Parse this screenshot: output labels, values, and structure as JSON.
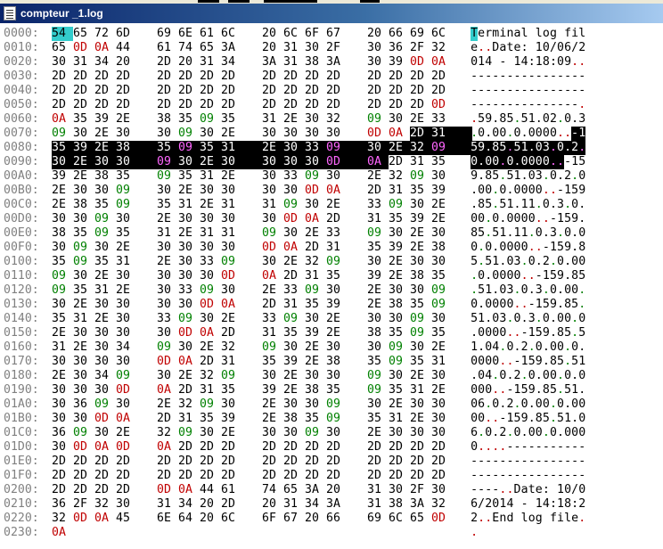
{
  "window": {
    "title": "compteur _1.log"
  },
  "colors": {
    "text": "#000000",
    "control": "#008000",
    "newline": "#c00000",
    "cursor": "#33cccc",
    "selection": "#000000"
  },
  "cursor_offset": 0,
  "selection_range": [
    126,
    156
  ],
  "rows": [
    {
      "addr": "0000:",
      "hex": "54 65 72 6D 69 6E 61 6C 20 6C 6F 67 20 66 69 6C",
      "ascii": "Terminal log fil"
    },
    {
      "addr": "0010:",
      "hex": "65 0D 0A 44 61 74 65 3A 20 31 30 2F 30 36 2F 32",
      "ascii": "e..Date: 10/06/2"
    },
    {
      "addr": "0020:",
      "hex": "30 31 34 20 2D 20 31 34 3A 31 38 3A 30 39 0D 0A",
      "ascii": "014 - 14:18:09.."
    },
    {
      "addr": "0030:",
      "hex": "2D 2D 2D 2D 2D 2D 2D 2D 2D 2D 2D 2D 2D 2D 2D 2D",
      "ascii": "----------------"
    },
    {
      "addr": "0040:",
      "hex": "2D 2D 2D 2D 2D 2D 2D 2D 2D 2D 2D 2D 2D 2D 2D 2D",
      "ascii": "----------------"
    },
    {
      "addr": "0050:",
      "hex": "2D 2D 2D 2D 2D 2D 2D 2D 2D 2D 2D 2D 2D 2D 2D 0D",
      "ascii": "---------------."
    },
    {
      "addr": "0060:",
      "hex": "0A 35 39 2E 38 35 09 35 31 2E 30 32 09 30 2E 33",
      "ascii": ".59.85.51.02.0.3"
    },
    {
      "addr": "0070:",
      "hex": "09 30 2E 30 30 09 30 2E 30 30 30 30 0D 0A 2D 31",
      "ascii": ".0.00.0.0000..-1"
    },
    {
      "addr": "0080:",
      "hex": "35 39 2E 38 35 09 35 31 2E 30 33 09 30 2E 32 09",
      "ascii": "59.85.51.03.0.2."
    },
    {
      "addr": "0090:",
      "hex": "30 2E 30 30 09 30 2E 30 30 30 30 0D 0A 2D 31 35",
      "ascii": "0.00.0.0000..-15"
    },
    {
      "addr": "00A0:",
      "hex": "39 2E 38 35 09 35 31 2E 30 33 09 30 2E 32 09 30",
      "ascii": "9.85.51.03.0.2.0"
    },
    {
      "addr": "00B0:",
      "hex": "2E 30 30 09 30 2E 30 30 30 30 0D 0A 2D 31 35 39",
      "ascii": ".00.0.0000..-159"
    },
    {
      "addr": "00C0:",
      "hex": "2E 38 35 09 35 31 2E 31 31 09 30 2E 33 09 30 2E",
      "ascii": ".85.51.11.0.3.0."
    },
    {
      "addr": "00D0:",
      "hex": "30 30 09 30 2E 30 30 30 30 0D 0A 2D 31 35 39 2E",
      "ascii": "00.0.0000..-159."
    },
    {
      "addr": "00E0:",
      "hex": "38 35 09 35 31 2E 31 31 09 30 2E 33 09 30 2E 30",
      "ascii": "85.51.11.0.3.0.0"
    },
    {
      "addr": "00F0:",
      "hex": "30 09 30 2E 30 30 30 30 0D 0A 2D 31 35 39 2E 38",
      "ascii": "0.0.0000..-159.8"
    },
    {
      "addr": "0100:",
      "hex": "35 09 35 31 2E 30 33 09 30 2E 32 09 30 2E 30 30",
      "ascii": "5.51.03.0.2.0.00"
    },
    {
      "addr": "0110:",
      "hex": "09 30 2E 30 30 30 30 0D 0A 2D 31 35 39 2E 38 35",
      "ascii": ".0.0000..-159.85"
    },
    {
      "addr": "0120:",
      "hex": "09 35 31 2E 30 33 09 30 2E 33 09 30 2E 30 30 09",
      "ascii": ".51.03.0.3.0.00."
    },
    {
      "addr": "0130:",
      "hex": "30 2E 30 30 30 30 0D 0A 2D 31 35 39 2E 38 35 09",
      "ascii": "0.0000..-159.85."
    },
    {
      "addr": "0140:",
      "hex": "35 31 2E 30 33 09 30 2E 33 09 30 2E 30 30 09 30",
      "ascii": "51.03.0.3.0.00.0"
    },
    {
      "addr": "0150:",
      "hex": "2E 30 30 30 30 0D 0A 2D 31 35 39 2E 38 35 09 35",
      "ascii": ".0000..-159.85.5"
    },
    {
      "addr": "0160:",
      "hex": "31 2E 30 34 09 30 2E 32 09 30 2E 30 30 09 30 2E",
      "ascii": "1.04.0.2.0.00.0."
    },
    {
      "addr": "0170:",
      "hex": "30 30 30 30 0D 0A 2D 31 35 39 2E 38 35 09 35 31",
      "ascii": "0000..-159.85.51"
    },
    {
      "addr": "0180:",
      "hex": "2E 30 34 09 30 2E 32 09 30 2E 30 30 09 30 2E 30",
      "ascii": ".04.0.2.0.00.0.0"
    },
    {
      "addr": "0190:",
      "hex": "30 30 30 0D 0A 2D 31 35 39 2E 38 35 09 35 31 2E",
      "ascii": "000..-159.85.51."
    },
    {
      "addr": "01A0:",
      "hex": "30 36 09 30 2E 32 09 30 2E 30 30 09 30 2E 30 30",
      "ascii": "06.0.2.0.00.0.00"
    },
    {
      "addr": "01B0:",
      "hex": "30 30 0D 0A 2D 31 35 39 2E 38 35 09 35 31 2E 30",
      "ascii": "00..-159.85.51.0"
    },
    {
      "addr": "01C0:",
      "hex": "36 09 30 2E 32 09 30 2E 30 30 09 30 2E 30 30 30",
      "ascii": "6.0.2.0.00.0.000"
    },
    {
      "addr": "01D0:",
      "hex": "30 0D 0A 0D 0A 2D 2D 2D 2D 2D 2D 2D 2D 2D 2D 2D",
      "ascii": "0....-----------"
    },
    {
      "addr": "01E0:",
      "hex": "2D 2D 2D 2D 2D 2D 2D 2D 2D 2D 2D 2D 2D 2D 2D 2D",
      "ascii": "----------------"
    },
    {
      "addr": "01F0:",
      "hex": "2D 2D 2D 2D 2D 2D 2D 2D 2D 2D 2D 2D 2D 2D 2D 2D",
      "ascii": "----------------"
    },
    {
      "addr": "0200:",
      "hex": "2D 2D 2D 2D 0D 0A 44 61 74 65 3A 20 31 30 2F 30",
      "ascii": "----..Date: 10/0"
    },
    {
      "addr": "0210:",
      "hex": "36 2F 32 30 31 34 20 2D 20 31 34 3A 31 38 3A 32",
      "ascii": "6/2014 - 14:18:2"
    },
    {
      "addr": "0220:",
      "hex": "32 0D 0A 45 6E 64 20 6C 6F 67 20 66 69 6C 65 0D",
      "ascii": "2..End log file."
    },
    {
      "addr": "0230:",
      "hex": "0A",
      "ascii": "."
    }
  ]
}
